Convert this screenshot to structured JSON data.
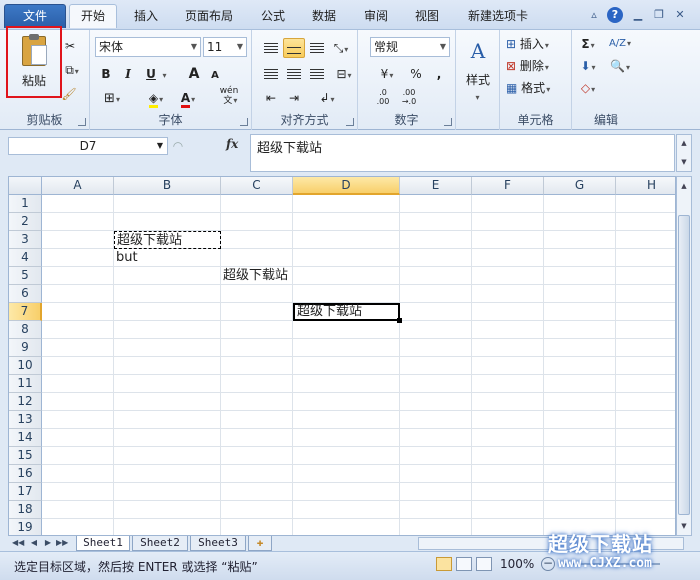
{
  "tabs": {
    "file": "文件",
    "items": [
      "开始",
      "插入",
      "页面布局",
      "公式",
      "数据",
      "审阅",
      "视图",
      "新建选项卡"
    ],
    "active": "开始"
  },
  "ribbon": {
    "clipboard": {
      "paste": "粘贴",
      "label": "剪贴板"
    },
    "font": {
      "name": "宋体",
      "size": "11",
      "label": "字体",
      "bold": "B",
      "italic": "I",
      "underline": "U",
      "grow": "A",
      "shrink": "A",
      "font_color": "A",
      "wen": "wén\n文"
    },
    "alignment": {
      "label": "对齐方式"
    },
    "number": {
      "format": "常规",
      "label": "数字",
      "percent": "%",
      "comma": ",",
      "inc_decimal": ".0\n.00",
      "dec_decimal": ".00\n→.0"
    },
    "styles": {
      "label": "样式"
    },
    "cells": {
      "insert": "插入",
      "delete": "删除",
      "format": "格式",
      "label": "单元格"
    },
    "editing": {
      "sigma": "Σ",
      "sort": "A/Z",
      "find": "A",
      "label": "编辑"
    }
  },
  "formula_bar": {
    "name_box": "D7",
    "fx": "fx",
    "content": "超级下载站"
  },
  "grid": {
    "columns": [
      "A",
      "B",
      "C",
      "D",
      "E",
      "F",
      "G",
      "H"
    ],
    "selected_column": "D",
    "rows": [
      "1",
      "2",
      "3",
      "4",
      "5",
      "6",
      "7",
      "8",
      "9",
      "10",
      "11",
      "12",
      "13",
      "14",
      "15",
      "16",
      "17",
      "18",
      "19"
    ],
    "selected_row": "7",
    "cells": {
      "B3": "超级下载站",
      "B4": "but",
      "C5": "超级下载站",
      "D7": "超级下载站"
    }
  },
  "sheets": [
    "Sheet1",
    "Sheet2",
    "Sheet3"
  ],
  "active_sheet": "Sheet1",
  "status": {
    "message": "选定目标区域，然后按 ENTER 或选择 “粘贴”",
    "zoom": "100%"
  },
  "watermark": {
    "title": "超级下载站",
    "url": "www.CJXZ.com"
  },
  "colors": {
    "accent": "#2a5ea8",
    "selection": "#f8cf6a",
    "highlight_box": "#e0141b"
  }
}
